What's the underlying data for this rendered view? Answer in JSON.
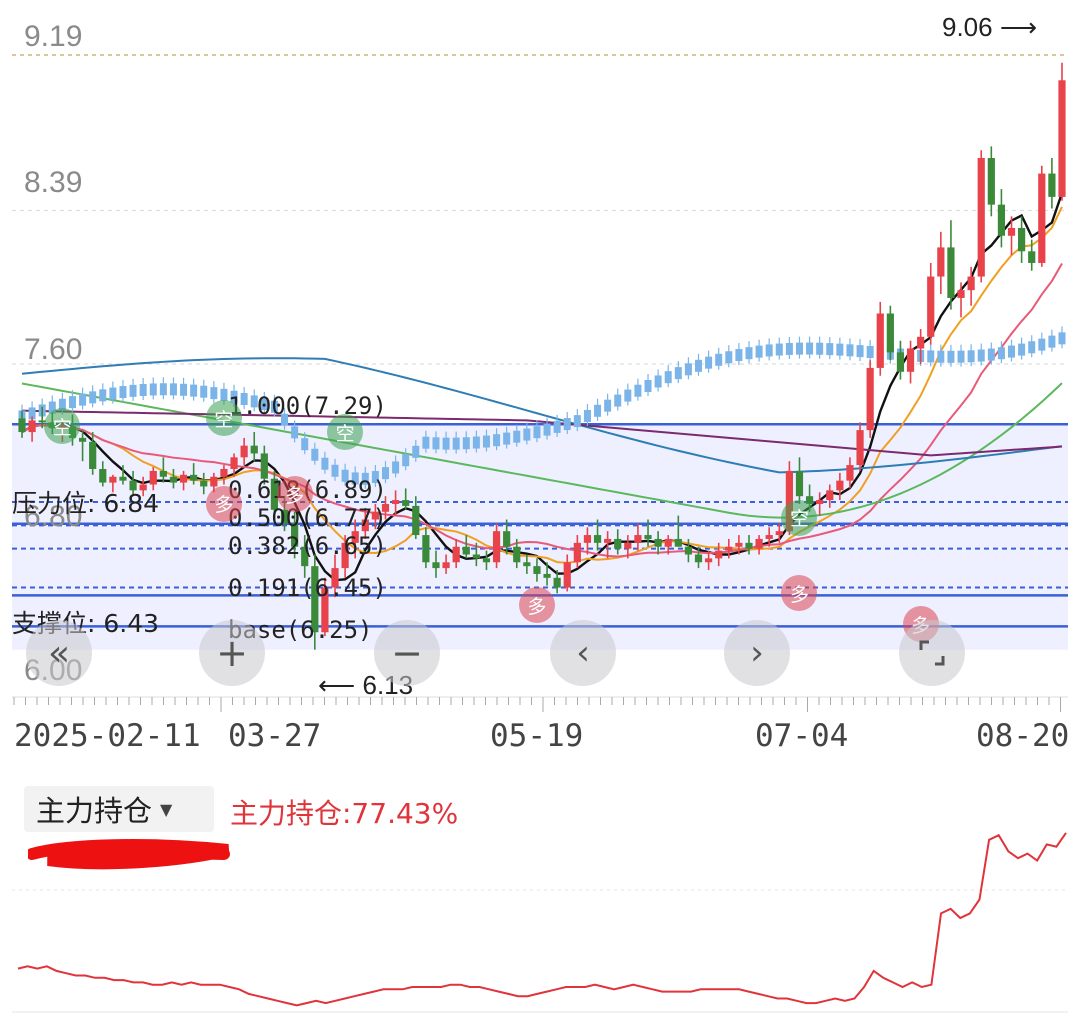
{
  "chart_data": [
    {
      "type": "candlestick",
      "title": "",
      "y_ticks": [
        "9.19",
        "8.39",
        "7.60",
        "6.80",
        "6.00"
      ],
      "ylim": [
        5.95,
        9.3
      ],
      "x_ticks": [
        "2025-02-11",
        "03-27",
        "05-19",
        "07-04",
        "08-20"
      ],
      "max_marker": "9.06",
      "min_marker": "6.13",
      "resistance_label": "压力位: 6.84",
      "support_label": "支撑位: 6.43",
      "fibonacci": [
        {
          "label": "1.000(7.29)",
          "price": 7.29
        },
        {
          "label": "0.618(6.89)",
          "price": 6.89
        },
        {
          "label": "0.500(6.77)",
          "price": 6.77
        },
        {
          "label": "0.382(6.65)",
          "price": 6.65
        },
        {
          "label": "0.191(6.45)",
          "price": 6.45
        },
        {
          "label": "base(6.25)",
          "price": 6.25
        }
      ],
      "signals": [
        {
          "text": "空",
          "kind": "sell",
          "x": 4,
          "price": 7.28
        },
        {
          "text": "空",
          "kind": "sell",
          "x": 20,
          "price": 7.32
        },
        {
          "text": "空",
          "kind": "sell",
          "x": 32,
          "price": 7.25
        },
        {
          "text": "多",
          "kind": "buy",
          "x": 20,
          "price": 6.88
        },
        {
          "text": "多",
          "kind": "buy",
          "x": 27,
          "price": 6.93
        },
        {
          "text": "多",
          "kind": "buy",
          "x": 51,
          "price": 6.36
        },
        {
          "text": "空",
          "kind": "sell",
          "x": 77,
          "price": 6.81
        },
        {
          "text": "多",
          "kind": "buy",
          "x": 77,
          "price": 6.42
        },
        {
          "text": "多",
          "kind": "buy",
          "x": 89,
          "price": 6.26
        }
      ],
      "candles": [
        [
          7.32,
          7.36,
          7.22,
          7.25
        ],
        [
          7.25,
          7.33,
          7.2,
          7.31
        ],
        [
          7.31,
          7.38,
          7.27,
          7.3
        ],
        [
          7.3,
          7.35,
          7.24,
          7.27
        ],
        [
          7.27,
          7.31,
          7.2,
          7.28
        ],
        [
          7.28,
          7.34,
          7.18,
          7.22
        ],
        [
          7.22,
          7.26,
          7.1,
          7.2
        ],
        [
          7.2,
          7.25,
          7.03,
          7.06
        ],
        [
          7.06,
          7.1,
          6.97,
          6.99
        ],
        [
          6.99,
          7.03,
          6.94,
          7.02
        ],
        [
          7.02,
          7.08,
          6.98,
          7.0
        ],
        [
          7.0,
          7.05,
          6.93,
          6.95
        ],
        [
          6.95,
          7.02,
          6.92,
          6.98
        ],
        [
          6.98,
          7.07,
          6.95,
          7.05
        ],
        [
          7.05,
          7.12,
          6.99,
          7.02
        ],
        [
          7.02,
          7.06,
          6.96,
          6.99
        ],
        [
          6.99,
          7.05,
          6.95,
          7.03
        ],
        [
          7.03,
          7.09,
          6.98,
          7.0
        ],
        [
          7.0,
          7.04,
          6.93,
          6.97
        ],
        [
          6.97,
          7.04,
          6.94,
          7.02
        ],
        [
          7.02,
          7.08,
          6.98,
          7.06
        ],
        [
          7.06,
          7.14,
          7.02,
          7.12
        ],
        [
          7.12,
          7.22,
          7.08,
          7.18
        ],
        [
          7.18,
          7.25,
          7.1,
          7.14
        ],
        [
          7.14,
          7.18,
          6.98,
          7.01
        ],
        [
          7.01,
          7.05,
          6.8,
          6.85
        ],
        [
          6.85,
          6.92,
          6.74,
          6.78
        ],
        [
          6.78,
          6.84,
          6.6,
          6.66
        ],
        [
          6.66,
          6.72,
          6.5,
          6.56
        ],
        [
          6.56,
          6.62,
          6.13,
          6.22
        ],
        [
          6.22,
          6.5,
          6.2,
          6.45
        ],
        [
          6.45,
          6.62,
          6.4,
          6.55
        ],
        [
          6.55,
          6.72,
          6.5,
          6.68
        ],
        [
          6.68,
          6.8,
          6.6,
          6.74
        ],
        [
          6.74,
          6.86,
          6.7,
          6.8
        ],
        [
          6.8,
          6.88,
          6.75,
          6.84
        ],
        [
          6.84,
          6.92,
          6.8,
          6.88
        ],
        [
          6.88,
          6.95,
          6.82,
          6.9
        ],
        [
          6.9,
          6.96,
          6.85,
          6.87
        ],
        [
          6.87,
          6.92,
          6.7,
          6.72
        ],
        [
          6.72,
          6.76,
          6.55,
          6.58
        ],
        [
          6.58,
          6.64,
          6.5,
          6.55
        ],
        [
          6.55,
          6.62,
          6.52,
          6.58
        ],
        [
          6.58,
          6.7,
          6.55,
          6.66
        ],
        [
          6.66,
          6.72,
          6.6,
          6.62
        ],
        [
          6.62,
          6.68,
          6.56,
          6.6
        ],
        [
          6.6,
          6.64,
          6.54,
          6.58
        ],
        [
          6.58,
          6.78,
          6.55,
          6.74
        ],
        [
          6.74,
          6.8,
          6.62,
          6.66
        ],
        [
          6.66,
          6.7,
          6.55,
          6.58
        ],
        [
          6.58,
          6.62,
          6.52,
          6.56
        ],
        [
          6.56,
          6.6,
          6.48,
          6.52
        ],
        [
          6.52,
          6.58,
          6.46,
          6.5
        ],
        [
          6.5,
          6.54,
          6.42,
          6.45
        ],
        [
          6.45,
          6.62,
          6.43,
          6.58
        ],
        [
          6.58,
          6.72,
          6.55,
          6.68
        ],
        [
          6.68,
          6.76,
          6.62,
          6.72
        ],
        [
          6.72,
          6.8,
          6.64,
          6.68
        ],
        [
          6.68,
          6.74,
          6.6,
          6.7
        ],
        [
          6.7,
          6.75,
          6.62,
          6.65
        ],
        [
          6.65,
          6.72,
          6.6,
          6.68
        ],
        [
          6.68,
          6.78,
          6.64,
          6.72
        ],
        [
          6.72,
          6.8,
          6.66,
          6.7
        ],
        [
          6.7,
          6.74,
          6.62,
          6.66
        ],
        [
          6.66,
          6.72,
          6.62,
          6.7
        ],
        [
          6.7,
          6.82,
          6.66,
          6.66
        ],
        [
          6.66,
          6.7,
          6.58,
          6.62
        ],
        [
          6.62,
          6.66,
          6.55,
          6.58
        ],
        [
          6.58,
          6.64,
          6.54,
          6.6
        ],
        [
          6.6,
          6.68,
          6.56,
          6.64
        ],
        [
          6.64,
          6.7,
          6.6,
          6.66
        ],
        [
          6.66,
          6.72,
          6.62,
          6.68
        ],
        [
          6.68,
          6.72,
          6.62,
          6.65
        ],
        [
          6.65,
          6.72,
          6.62,
          6.7
        ],
        [
          6.7,
          6.76,
          6.66,
          6.72
        ],
        [
          6.72,
          6.78,
          6.68,
          6.74
        ],
        [
          6.74,
          7.1,
          6.72,
          7.05
        ],
        [
          7.05,
          7.12,
          6.88,
          6.92
        ],
        [
          6.92,
          6.98,
          6.84,
          6.88
        ],
        [
          6.88,
          6.94,
          6.82,
          6.9
        ],
        [
          6.9,
          6.98,
          6.86,
          6.95
        ],
        [
          6.95,
          7.04,
          6.9,
          7.0
        ],
        [
          7.0,
          7.12,
          6.96,
          7.08
        ],
        [
          7.08,
          7.3,
          7.05,
          7.26
        ],
        [
          7.26,
          7.62,
          7.22,
          7.58
        ],
        [
          7.58,
          7.92,
          7.54,
          7.86
        ],
        [
          7.86,
          7.9,
          7.62,
          7.66
        ],
        [
          7.66,
          7.72,
          7.52,
          7.56
        ],
        [
          7.56,
          7.72,
          7.5,
          7.68
        ],
        [
          7.68,
          7.78,
          7.6,
          7.74
        ],
        [
          7.74,
          8.12,
          7.7,
          8.05
        ],
        [
          8.05,
          8.28,
          7.96,
          8.2
        ],
        [
          8.2,
          8.34,
          7.88,
          7.94
        ],
        [
          7.94,
          8.02,
          7.84,
          7.98
        ],
        [
          7.98,
          8.1,
          7.9,
          8.05
        ],
        [
          8.05,
          8.7,
          8.02,
          8.66
        ],
        [
          8.66,
          8.72,
          8.36,
          8.42
        ],
        [
          8.42,
          8.5,
          8.2,
          8.26
        ],
        [
          8.26,
          8.36,
          8.16,
          8.3
        ],
        [
          8.3,
          8.36,
          8.12,
          8.18
        ],
        [
          8.18,
          8.24,
          8.08,
          8.12
        ],
        [
          8.12,
          8.62,
          8.1,
          8.58
        ],
        [
          8.58,
          8.66,
          8.4,
          8.46
        ],
        [
          8.46,
          9.15,
          8.44,
          9.06
        ]
      ],
      "ma_lines": [
        {
          "name": "MA5",
          "color": "#111111"
        },
        {
          "name": "MA10",
          "color": "#f0a020"
        },
        {
          "name": "MA20",
          "color": "#e85a78"
        },
        {
          "name": "MA60",
          "color": "#5cb85c"
        },
        {
          "name": "MA120",
          "color": "#2e7db5"
        },
        {
          "name": "MA250",
          "color": "#7b2a6e"
        }
      ],
      "colors": {
        "up": "#e8424a",
        "down": "#3a8a3a",
        "projection": "#7ab4e8",
        "fib_line": "#3b5fd6",
        "band": "#eef0ff"
      }
    },
    {
      "type": "line",
      "indicator_name": "主力持仓",
      "value_label": "主力持仓:77.43%",
      "color": "#e0333a",
      "values": [
        0.18,
        0.19,
        0.18,
        0.19,
        0.17,
        0.16,
        0.15,
        0.15,
        0.14,
        0.14,
        0.13,
        0.13,
        0.12,
        0.12,
        0.11,
        0.11,
        0.12,
        0.11,
        0.12,
        0.11,
        0.11,
        0.11,
        0.1,
        0.09,
        0.07,
        0.06,
        0.05,
        0.04,
        0.03,
        0.02,
        0.03,
        0.04,
        0.03,
        0.04,
        0.05,
        0.06,
        0.07,
        0.08,
        0.09,
        0.09,
        0.09,
        0.1,
        0.1,
        0.1,
        0.1,
        0.11,
        0.11,
        0.1,
        0.1,
        0.09,
        0.08,
        0.07,
        0.06,
        0.06,
        0.07,
        0.08,
        0.09,
        0.1,
        0.1,
        0.1,
        0.11,
        0.1,
        0.09,
        0.1,
        0.11,
        0.1,
        0.09,
        0.08,
        0.08,
        0.08,
        0.08,
        0.09,
        0.09,
        0.09,
        0.09,
        0.09,
        0.08,
        0.07,
        0.06,
        0.05,
        0.05,
        0.04,
        0.03,
        0.03,
        0.04,
        0.05,
        0.04,
        0.05,
        0.1,
        0.17,
        0.14,
        0.12,
        0.1,
        0.12,
        0.1,
        0.11,
        0.42,
        0.44,
        0.4,
        0.42,
        0.48,
        0.74,
        0.76,
        0.69,
        0.66,
        0.68,
        0.65,
        0.72,
        0.71,
        0.77
      ]
    }
  ],
  "controls": {
    "scroll_left_icon": "double-chevron-left-icon",
    "zoom_in_icon": "plus-icon",
    "zoom_out_icon": "minus-icon",
    "prev_icon": "chevron-left-icon",
    "next_icon": "chevron-right-icon",
    "fullscreen_icon": "fullscreen-icon"
  },
  "indicator_panel": {
    "selector_label": "主力持仓",
    "value_text": "主力持仓:77.43%"
  }
}
